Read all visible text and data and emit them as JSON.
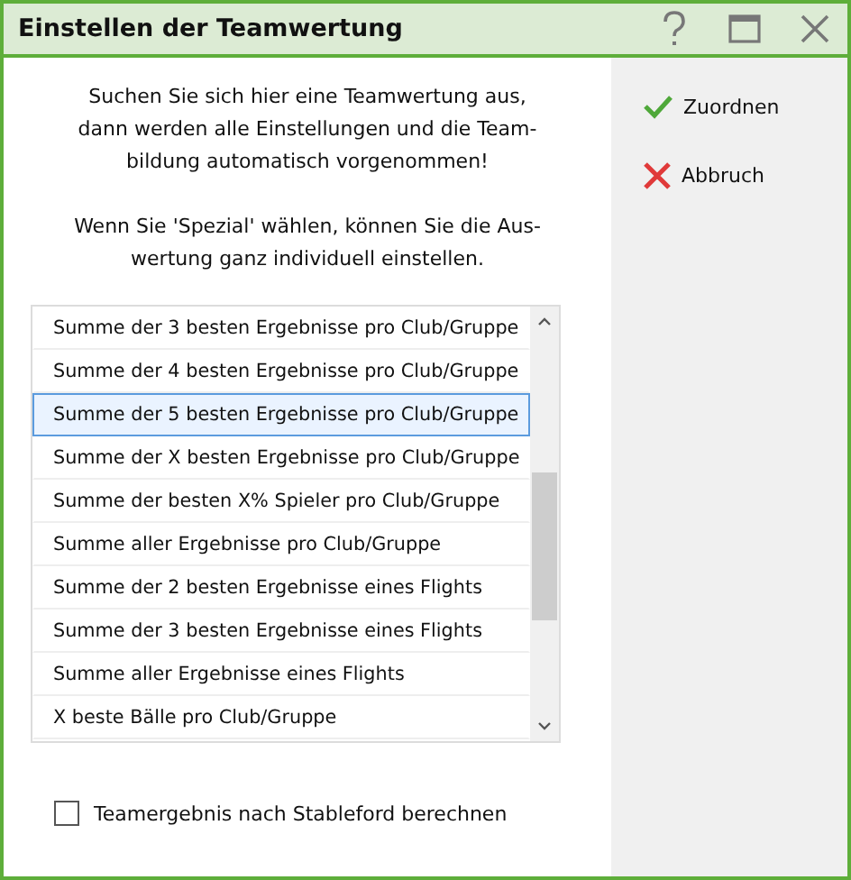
{
  "window": {
    "title": "Einstellen der Teamwertung"
  },
  "intro": [
    [
      "Suchen Sie sich hier eine Teamwertung aus,",
      "dann werden alle Einstellungen und die Team-",
      "bildung automatisch vorgenommen!"
    ],
    [
      "Wenn Sie 'Spezial' wählen, können Sie die Aus-",
      "wertung ganz individuell einstellen."
    ]
  ],
  "list": {
    "items": [
      {
        "label": "Summe der 3 besten Ergebnisse pro Club/Gruppe",
        "selected": false
      },
      {
        "label": "Summe der 4 besten Ergebnisse pro Club/Gruppe",
        "selected": false
      },
      {
        "label": "Summe der 5 besten Ergebnisse pro Club/Gruppe",
        "selected": true
      },
      {
        "label": "Summe der X besten Ergebnisse pro Club/Gruppe",
        "selected": false
      },
      {
        "label": "Summe der besten X% Spieler pro Club/Gruppe",
        "selected": false
      },
      {
        "label": "Summe aller Ergebnisse pro Club/Gruppe",
        "selected": false
      },
      {
        "label": "Summe der 2 besten Ergebnisse eines Flights",
        "selected": false
      },
      {
        "label": "Summe der 3 besten Ergebnisse eines Flights",
        "selected": false
      },
      {
        "label": "Summe aller Ergebnisse eines Flights",
        "selected": false
      },
      {
        "label": "X beste Bälle pro Club/Gruppe",
        "selected": false
      }
    ]
  },
  "checkbox": {
    "label": "Teamergebnis nach Stableford berechnen",
    "checked": false
  },
  "buttons": [
    {
      "kind": "confirm",
      "label": "Zuordnen"
    },
    {
      "kind": "cancel",
      "label": "Abbruch"
    }
  ]
}
